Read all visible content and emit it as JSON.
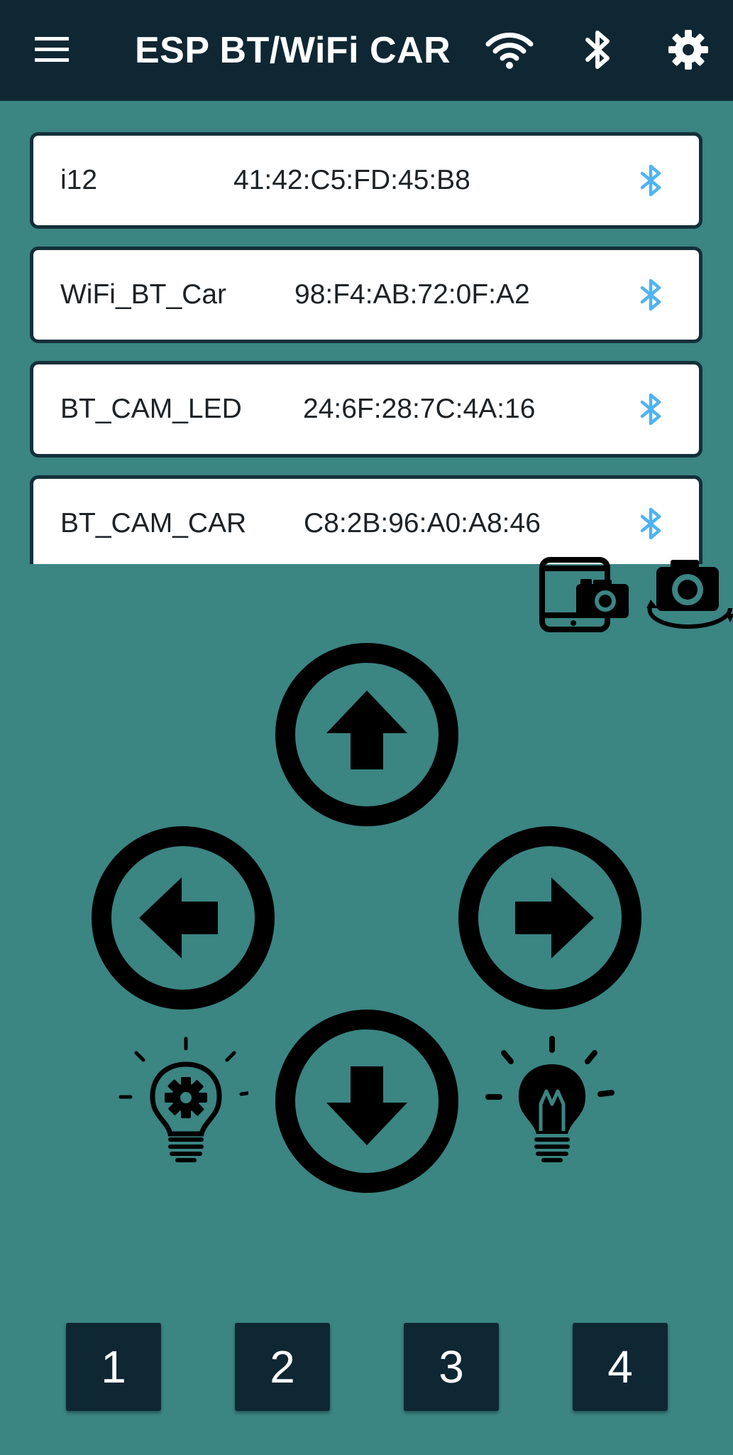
{
  "header": {
    "title": "ESP BT/WiFi CAR",
    "icons": {
      "menu": "hamburger-menu-icon",
      "wifi": "wifi-icon",
      "bluetooth": "bluetooth-icon",
      "settings": "gear-icon"
    }
  },
  "devices": [
    {
      "name": "i12",
      "mac": "41:42:C5:FD:45:B8",
      "icon": "bluetooth-icon"
    },
    {
      "name": "WiFi_BT_Car",
      "mac": "98:F4:AB:72:0F:A2",
      "icon": "bluetooth-icon"
    },
    {
      "name": "BT_CAM_LED",
      "mac": "24:6F:28:7C:4A:16",
      "icon": "bluetooth-icon"
    },
    {
      "name": "BT_CAM_CAR",
      "mac": "C8:2B:96:A0:A8:46",
      "icon": "bluetooth-icon"
    }
  ],
  "camera_controls": {
    "phone_camera_icon": "phone-camera-icon",
    "switch_camera_icon": "camera-switch-icon"
  },
  "direction_pad": {
    "up": "arrow-up-icon",
    "left": "arrow-left-icon",
    "right": "arrow-right-icon",
    "down": "arrow-down-icon"
  },
  "lights": {
    "auto_light": "bulb-gear-icon",
    "light_toggle": "bulb-on-icon"
  },
  "number_buttons": [
    "1",
    "2",
    "3",
    "4"
  ],
  "colors": {
    "background": "#3b8583",
    "app_bar": "#0f2733",
    "bluetooth_accent": "#4fb3f0",
    "card_background": "#ffffff",
    "number_button": "#0f2733"
  }
}
